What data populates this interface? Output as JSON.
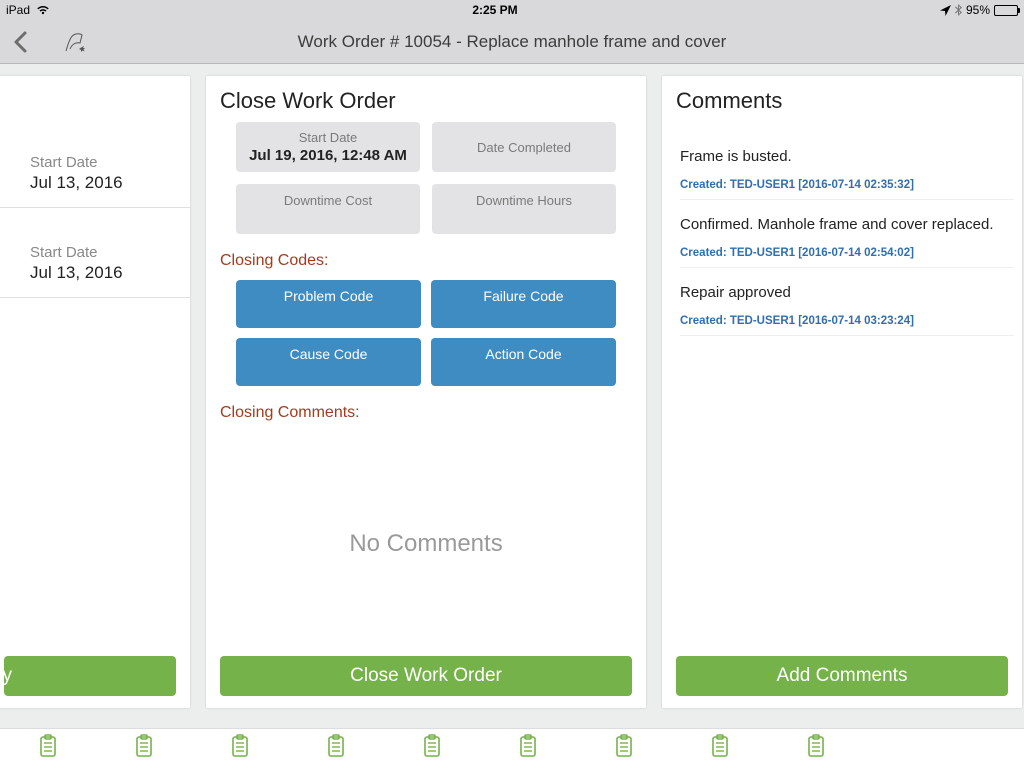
{
  "status": {
    "device": "iPad",
    "time": "2:25 PM",
    "battery_pct": "95%"
  },
  "nav": {
    "title": "Work Order # 10054 - Replace manhole frame and cover"
  },
  "left_panel": {
    "items": [
      {
        "label": "Start Date",
        "value": "Jul 13, 2016"
      },
      {
        "label": "Start Date",
        "value": "Jul 13, 2016"
      }
    ],
    "button": "tivity"
  },
  "mid_panel": {
    "title": "Close Work Order",
    "grey": [
      {
        "label": "Start Date",
        "value": "Jul 19, 2016, 12:48 AM"
      },
      {
        "label": "Date Completed",
        "value": ""
      },
      {
        "label": "Downtime Cost",
        "value": ""
      },
      {
        "label": "Downtime Hours",
        "value": ""
      }
    ],
    "codes_label": "Closing Codes:",
    "codes": [
      "Problem Code",
      "Failure Code",
      "Cause Code",
      "Action Code"
    ],
    "comments_label": "Closing Comments:",
    "no_comments": "No Comments",
    "button": "Close Work Order"
  },
  "right_panel": {
    "title": "Comments",
    "comments": [
      {
        "text": "Frame is busted.",
        "meta": "Created: TED-USER1 [2016-07-14 02:35:32]"
      },
      {
        "text": "Confirmed.  Manhole frame and cover replaced.",
        "meta": "Created: TED-USER1 [2016-07-14 02:54:02]"
      },
      {
        "text": "Repair approved",
        "meta": "Created: TED-USER1 [2016-07-14 03:23:24]"
      }
    ],
    "button": "Add Comments"
  }
}
